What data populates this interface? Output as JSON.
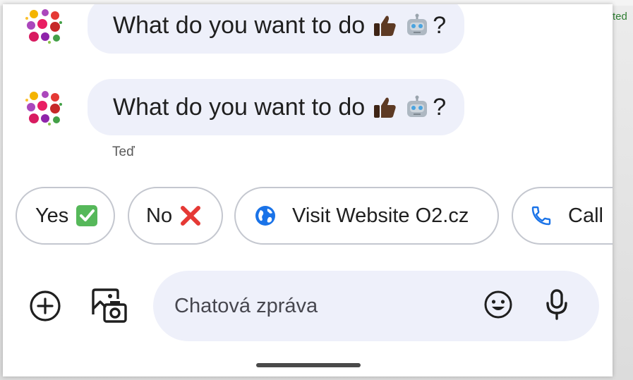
{
  "background": {
    "snippet": "ted"
  },
  "messages": [
    {
      "text": "What do you want to do",
      "emoji": [
        "thumbs-up",
        "robot"
      ],
      "suffix": "?"
    },
    {
      "text": "What do you want to do",
      "emoji": [
        "thumbs-up",
        "robot"
      ],
      "suffix": "?"
    }
  ],
  "timestamp": "Teď",
  "chips": [
    {
      "label": "Yes",
      "icon": "check-mark-icon",
      "color": "#56b85a"
    },
    {
      "label": "No",
      "icon": "cross-mark-icon",
      "color": "#e53935"
    },
    {
      "label": "Visit Website O2.cz",
      "icon": "globe-icon",
      "color": "#1a73e8"
    },
    {
      "label": "Call",
      "icon": "phone-icon",
      "color": "#1a73e8"
    }
  ],
  "compose": {
    "placeholder": "Chatová zpráva",
    "value": "",
    "buttons": [
      "add-circle-icon",
      "gallery-icon",
      "emoji-icon",
      "microphone-icon"
    ]
  },
  "colors": {
    "bubble_bg": "#eef0fa",
    "chip_border": "#c4c7cf",
    "accent": "#1a73e8",
    "skin_tone": "#5d3a24"
  }
}
